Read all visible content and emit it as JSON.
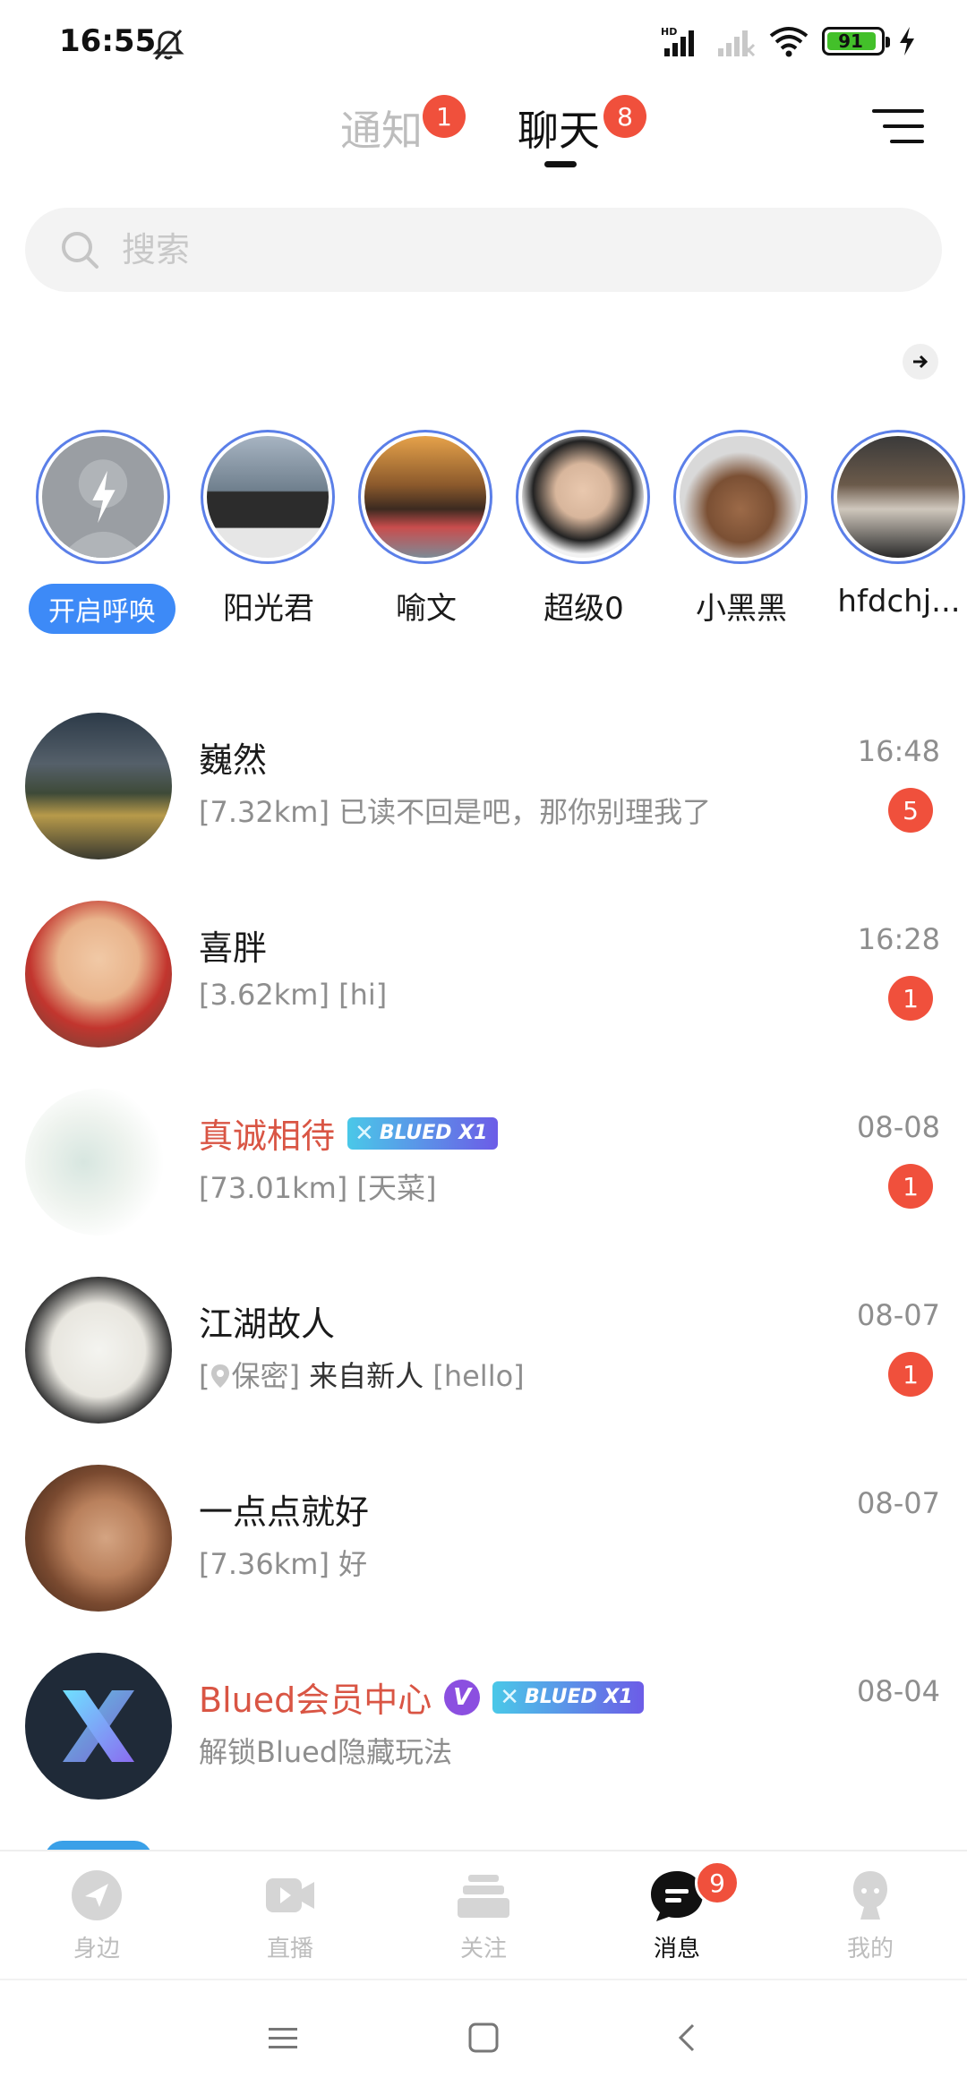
{
  "status_bar": {
    "time": "16:55",
    "battery": "91",
    "network_label": "HD"
  },
  "header": {
    "tabs": [
      {
        "label": "通知",
        "badge": "1"
      },
      {
        "label": "聊天",
        "badge": "8"
      }
    ]
  },
  "search": {
    "placeholder": "搜索"
  },
  "stories": {
    "call_button_label": "开启呼唤",
    "items": [
      {
        "name": "阳光君"
      },
      {
        "name": "喻文"
      },
      {
        "name": "超级0"
      },
      {
        "name": "小黑黑"
      },
      {
        "name": "hfdchj..."
      }
    ]
  },
  "chats": [
    {
      "name": "巍然",
      "time": "16:48",
      "distance": "[7.32km]",
      "message": "已读不回是吧，那你别理我了",
      "unread": "5"
    },
    {
      "name": "喜胖",
      "time": "16:28",
      "distance": "[3.62km]",
      "message": "[hi]",
      "unread": "1"
    },
    {
      "name": "真诚相待",
      "badge": "BLUED X1",
      "time": "08-08",
      "distance": "[73.01km]",
      "message": "[天菜]",
      "unread": "1"
    },
    {
      "name": "江湖故人",
      "time": "08-07",
      "distance_prefix": "[",
      "distance": "保密]",
      "tag": "来自新人",
      "message": "[hello]",
      "unread": "1"
    },
    {
      "name": "一点点就好",
      "time": "08-07",
      "distance": "[7.36km]",
      "message": "好"
    },
    {
      "name": "Blued会员中心",
      "verified": "V",
      "badge": "BLUED X1",
      "time": "08-04",
      "message": "解锁Blued隐藏玩法"
    }
  ],
  "bottom_nav": {
    "items": [
      {
        "label": "身边"
      },
      {
        "label": "直播"
      },
      {
        "label": "关注"
      },
      {
        "label": "消息",
        "badge": "9"
      },
      {
        "label": "我的"
      }
    ]
  },
  "colors": {
    "accent_red": "#f0503c",
    "brand_blue": "#3d8af7",
    "vip_name": "#d95544"
  },
  "icons": [
    "bell-off-icon",
    "signal-icon",
    "wifi-icon",
    "battery-icon",
    "charging-icon",
    "menu-icon",
    "search-icon",
    "arrow-right-icon",
    "lightning-icon",
    "location-pin-icon",
    "compass-icon",
    "video-icon",
    "stack-icon",
    "chat-icon",
    "profile-icon"
  ]
}
